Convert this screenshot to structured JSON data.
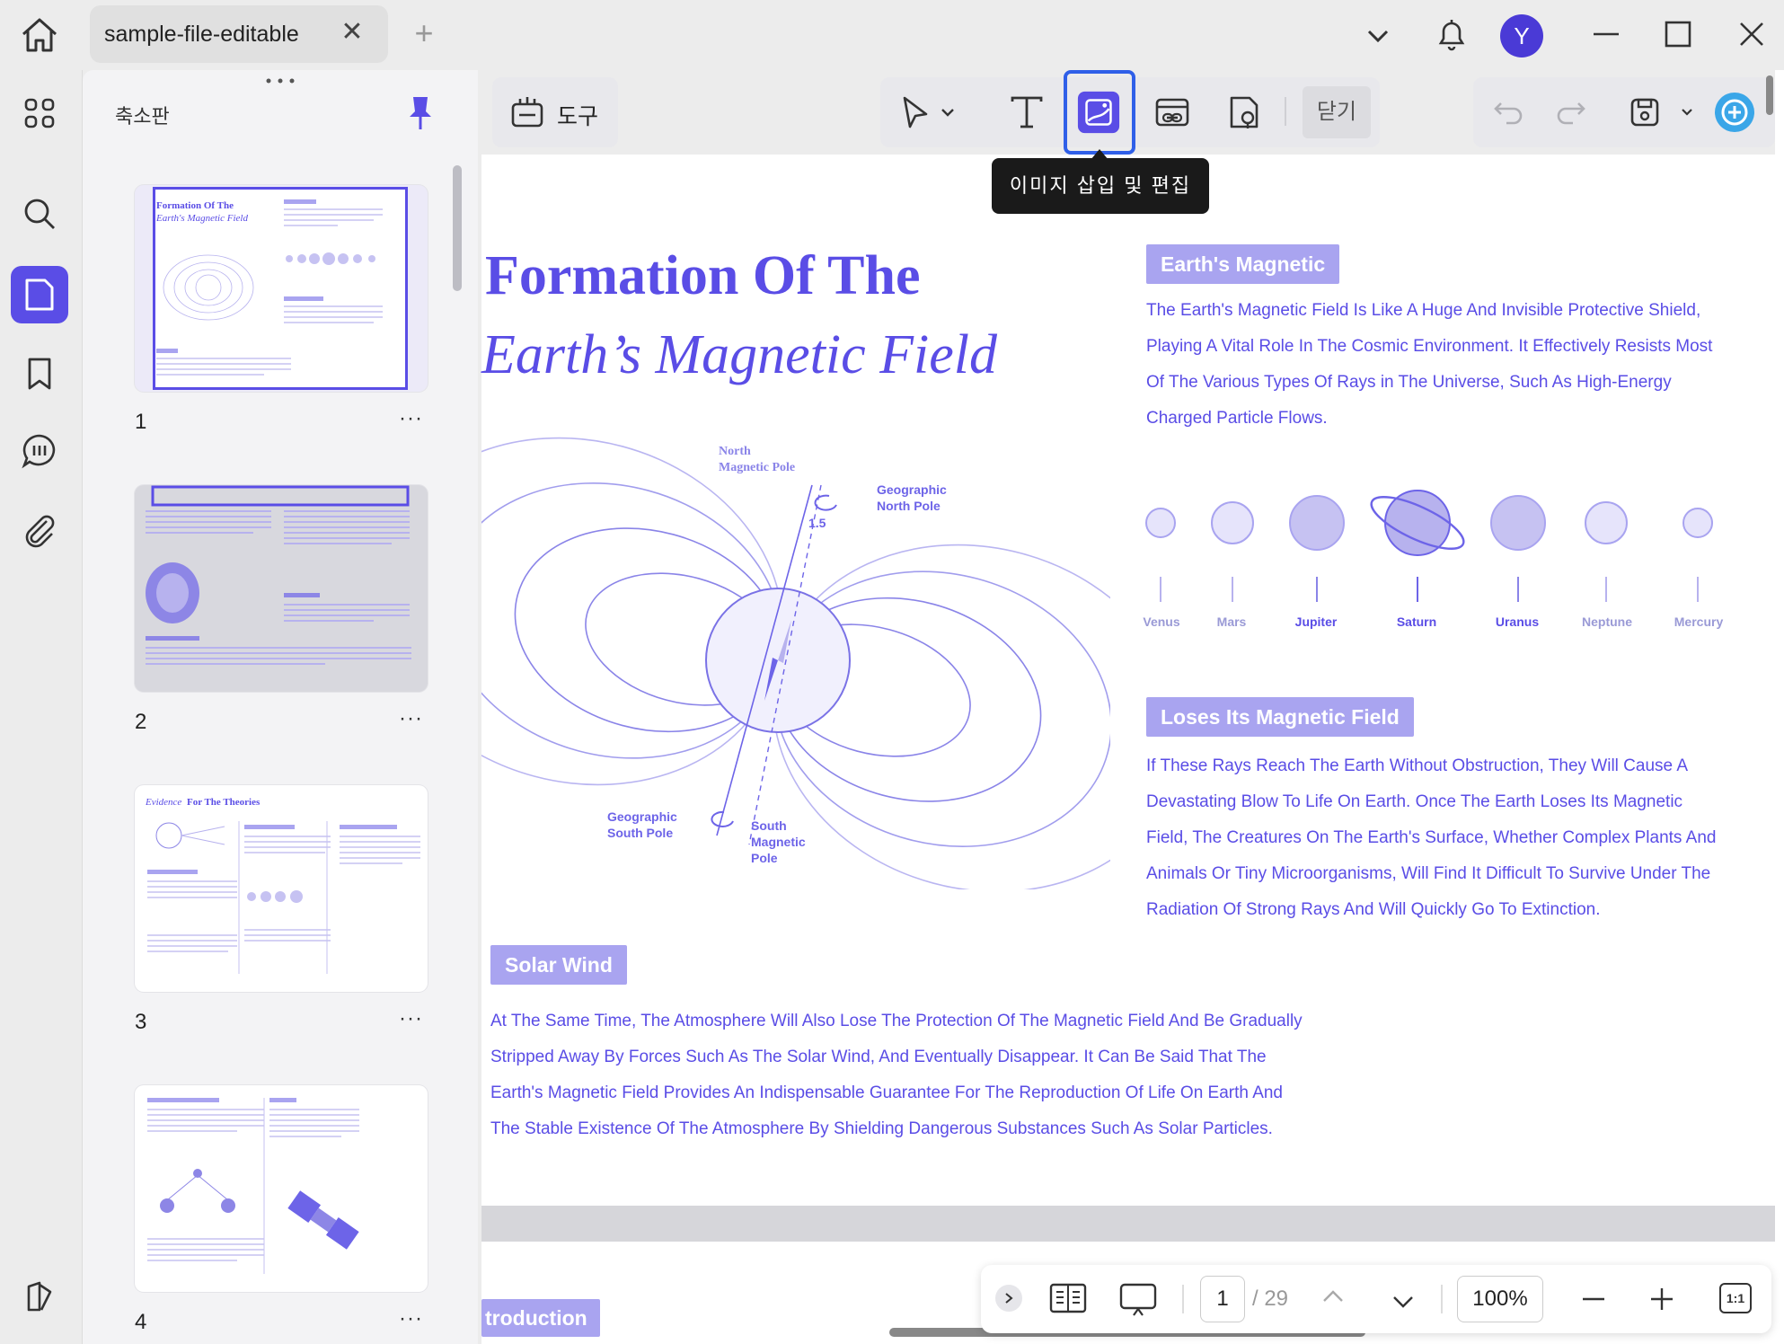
{
  "window": {
    "tab_title": "sample-file-editable",
    "avatar_letter": "Y"
  },
  "sidebar": {
    "panel_title": "축소판",
    "pages": [
      {
        "number": "1",
        "more": "···"
      },
      {
        "number": "2",
        "more": "···"
      },
      {
        "number": "3",
        "more": "···"
      },
      {
        "number": "4",
        "more": "···"
      }
    ]
  },
  "toolbar": {
    "tools_label": "도구",
    "close_label": "닫기",
    "tooltip": "이미지 삽입 및 편집"
  },
  "document": {
    "title_line1": "Formation Of The",
    "title_line2": "Earth’s Magnetic Field",
    "section1_title": "Earth's Magnetic",
    "section1_lines": [
      "The Earth's Magnetic Field Is Like A Huge And Invisible Protective Shield,",
      "Playing A Vital Role In The Cosmic Environment. It Effectively Resists Most",
      "Of The Various Types Of Rays in The Universe, Such As High-Energy",
      "Charged Particle Flows."
    ],
    "planets": [
      "Venus",
      "Mars",
      "Jupiter",
      "Saturn",
      "Uranus",
      "Neptune",
      "Mercury"
    ],
    "section2_title": "Loses Its Magnetic Field",
    "section2_lines": [
      "If These Rays Reach The Earth Without Obstruction, They Will Cause A",
      "Devastating Blow To Life On Earth. Once The Earth Loses Its Magnetic",
      "Field, The Creatures On The Earth's Surface, Whether Complex Plants And",
      "Animals Or Tiny Microorganisms, Will Find It Difficult To Survive Under The",
      "Radiation Of Strong Rays And Will Quickly Go To Extinction."
    ],
    "section3_title": "Solar Wind",
    "section3_lines": [
      "At The Same Time, The Atmosphere Will Also Lose The Protection Of The Magnetic Field And Be Gradually",
      "Stripped Away By Forces Such As The Solar Wind, And Eventually Disappear. It Can Be Said That The",
      "Earth's Magnetic Field Provides An Indispensable Guarantee For The Reproduction Of Life On Earth And",
      "The Stable Existence Of The Atmosphere By Shielding Dangerous Substances Such As Solar Particles."
    ],
    "diagram_labels": {
      "north_magnetic_pole_1": "North",
      "north_magnetic_pole_2": "Magnetic Pole",
      "geo_north_1": "Geographic",
      "geo_north_2": "North Pole",
      "angle": "1.5",
      "geo_south_1": "Geographic",
      "geo_south_2": "South Pole",
      "south_mag_1": "South",
      "south_mag_2": "Magnetic",
      "south_mag_3": "Pole"
    },
    "next_page_badge": "troduction"
  },
  "bottom_bar": {
    "current_page": "1",
    "total_pages": "/ 29",
    "zoom": "100%",
    "fit_label": "1:1"
  },
  "colors": {
    "accent": "#5a4de6",
    "badge": "#a9a4f0",
    "active_outline": "#2f5fe8"
  }
}
